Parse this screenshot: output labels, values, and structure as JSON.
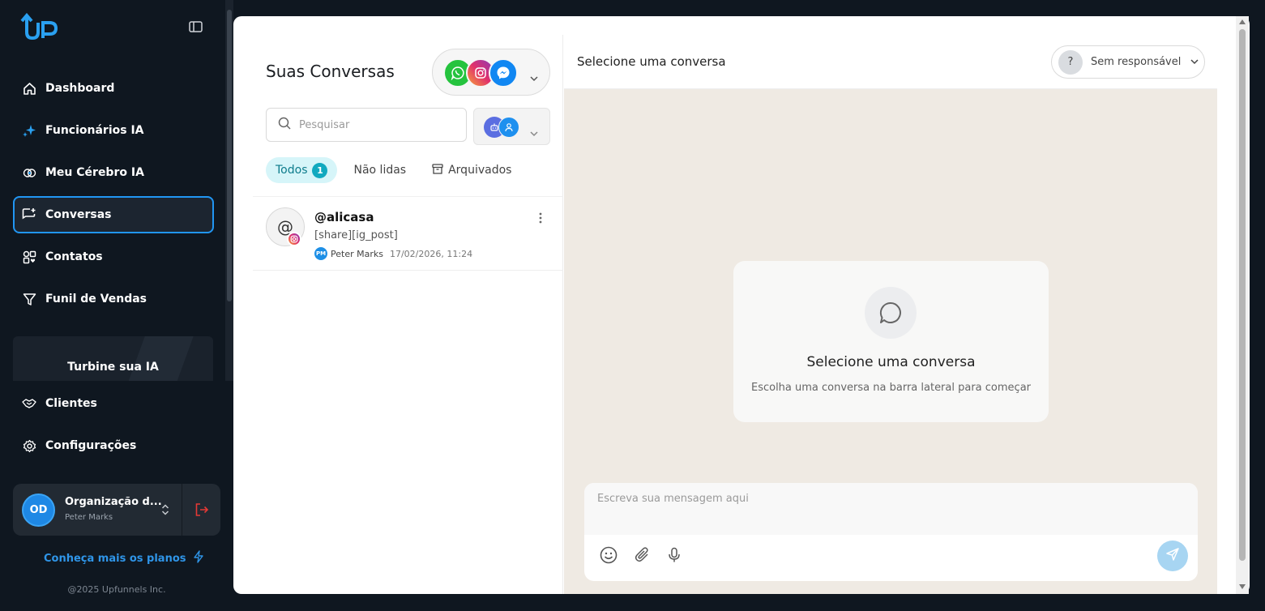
{
  "sidebar": {
    "logo_text": "UP",
    "items": [
      {
        "label": "Dashboard",
        "icon": "home-icon"
      },
      {
        "label": "Funcionários IA",
        "icon": "sparkles-icon"
      },
      {
        "label": "Meu Cérebro IA",
        "icon": "brain-icon"
      },
      {
        "label": "Conversas",
        "icon": "chat-plus-icon",
        "active": true
      },
      {
        "label": "Contatos",
        "icon": "contacts-icon"
      },
      {
        "label": "Funil de Vendas",
        "icon": "funnel-icon"
      },
      {
        "label": "Clientes",
        "icon": "handshake-icon"
      },
      {
        "label": "Configurações",
        "icon": "gear-icon"
      }
    ],
    "promo_title": "Turbine sua IA",
    "org": {
      "initials": "OD",
      "name": "Organização d...",
      "user": "Peter Marks"
    },
    "plans_link": "Conheça mais os planos",
    "copyright": "@2025 Upfunnels Inc."
  },
  "conversations": {
    "title": "Suas Conversas",
    "channels": [
      "whatsapp-icon",
      "instagram-icon",
      "messenger-icon"
    ],
    "search_placeholder": "Pesquisar",
    "tabs": {
      "all": "Todos",
      "all_count": "1",
      "unread": "Não lidas",
      "archived": "Arquivados"
    },
    "items": [
      {
        "avatar_symbol": "@",
        "name": "@alicasa",
        "preview": "[share][ig_post]",
        "agent_initials": "PM",
        "agent_name": "Peter Marks",
        "date": "17/02/2026, 11:24",
        "channel": "instagram-icon"
      }
    ]
  },
  "chat": {
    "header_title": "Selecione uma conversa",
    "assignee_symbol": "?",
    "assignee_label": "Sem responsável",
    "empty_title": "Selecione uma conversa",
    "empty_subtitle": "Escolha uma conversa na barra lateral para começar",
    "composer_placeholder": "Escreva sua mensagem aqui"
  },
  "colors": {
    "sidebar_bg": "#0f1720",
    "accent": "#2196f3",
    "tab_active_bg": "#d6f5f9",
    "chat_bg": "#efeae3"
  }
}
